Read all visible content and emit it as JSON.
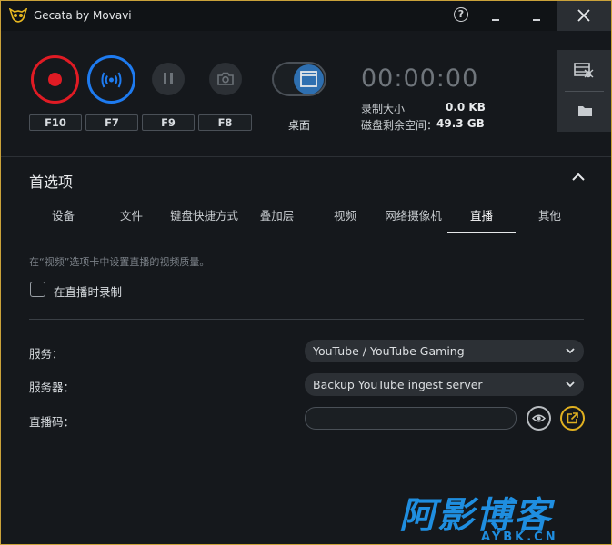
{
  "app": {
    "title": "Gecata by Movavi",
    "logo_icon": "owl-logo-icon",
    "accent_colors": {
      "record": "#e01b24",
      "stream": "#1e7bf0",
      "border": "#caa23a"
    }
  },
  "window_controls": {
    "help": "?"
  },
  "capture": {
    "hotkeys": {
      "record": "F10",
      "stream": "F7",
      "pause": "F9",
      "screenshot": "F8"
    },
    "mode_label": "桌面",
    "timer": "00:00:00",
    "stats": {
      "record_size_label": "录制大小",
      "record_size_value": "0.0 KB",
      "disk_free_label": "磁盘剩余空间：",
      "disk_free_value": "49.3 GB"
    }
  },
  "preferences": {
    "title": "首选项",
    "tabs": [
      {
        "label": "设备"
      },
      {
        "label": "文件"
      },
      {
        "label": "键盘快捷方式"
      },
      {
        "label": "叠加层"
      },
      {
        "label": "视频"
      },
      {
        "label": "网络摄像机"
      },
      {
        "label": "直播",
        "active": true
      },
      {
        "label": "其他"
      }
    ],
    "stream": {
      "hint": "在“视频”选项卡中设置直播的视频质量。",
      "record_while_streaming_label": "在直播时录制",
      "record_while_streaming_checked": false,
      "service_label": "服务：",
      "service_value": "YouTube / YouTube Gaming",
      "server_label": "服务器：",
      "server_value": "Backup YouTube ingest server",
      "stream_key_label": "直播码：",
      "stream_key_value": ""
    }
  },
  "watermark": {
    "main_text": "阿影博客",
    "sub_text": "AYBK.CN"
  }
}
